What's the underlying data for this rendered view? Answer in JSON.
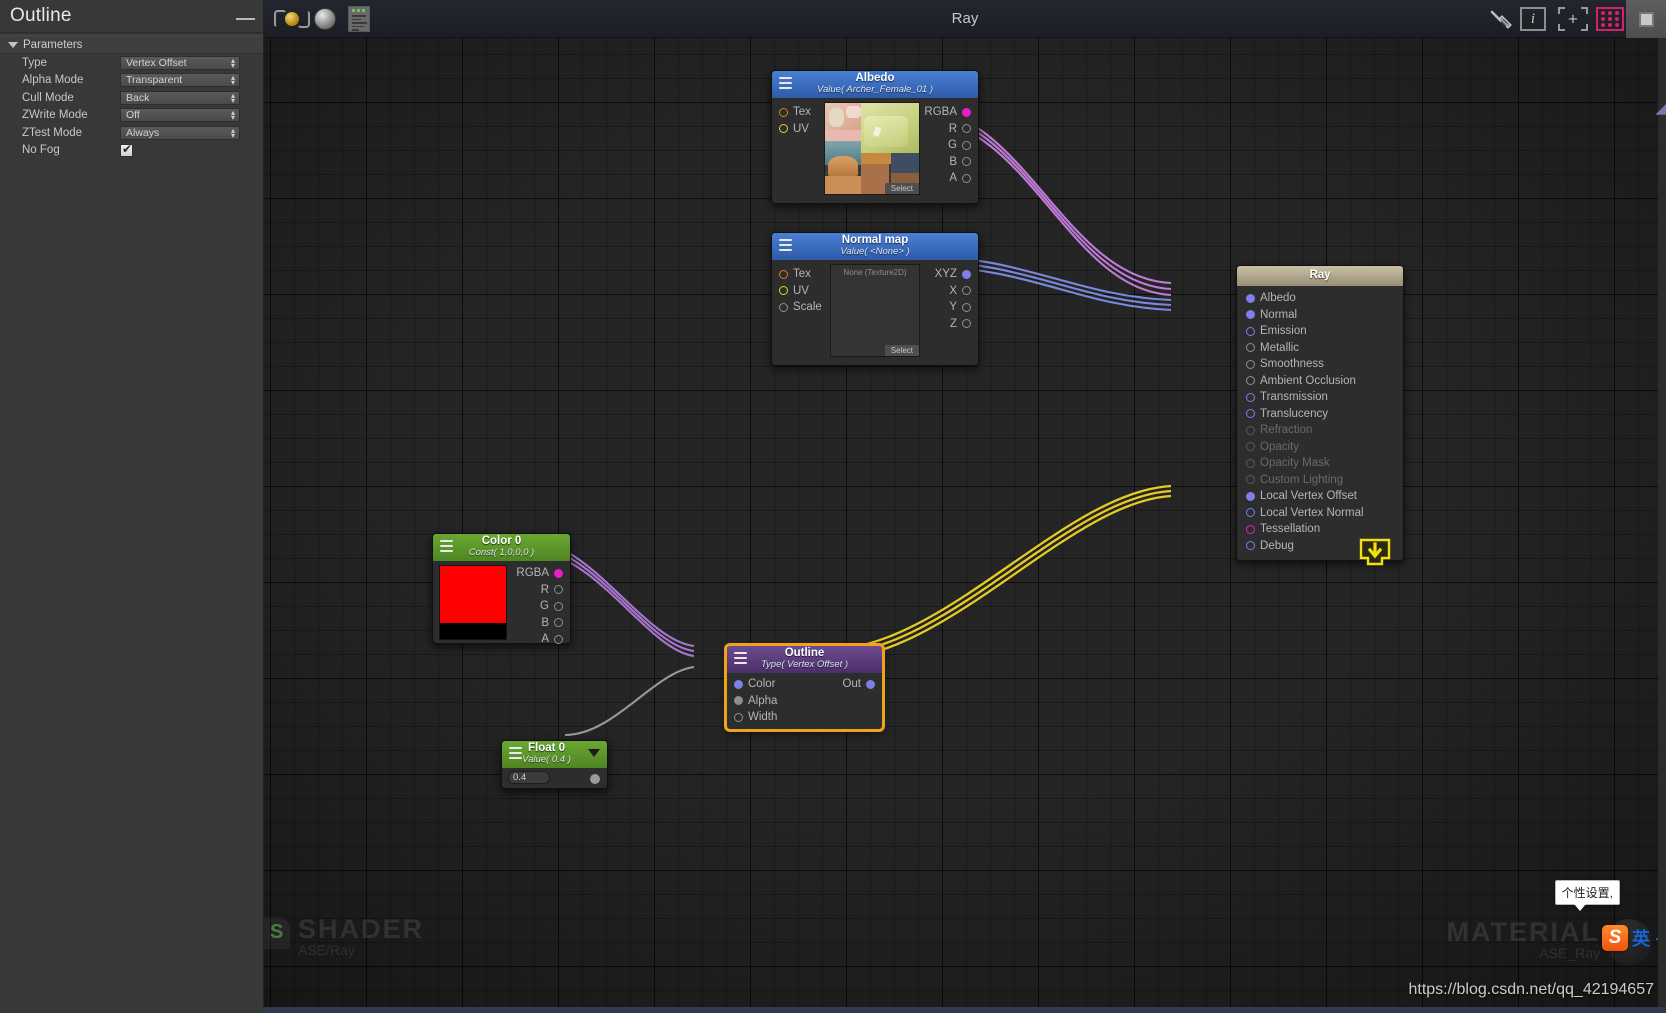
{
  "panel": {
    "title": "Outline",
    "section_label": "Parameters",
    "minimize_icon": "minimize-icon",
    "properties": [
      {
        "label": "Type",
        "value": "Vertex Offset",
        "control": "dropdown"
      },
      {
        "label": "Alpha Mode",
        "value": "Transparent",
        "control": "dropdown"
      },
      {
        "label": "Cull Mode",
        "value": "Back",
        "control": "dropdown"
      },
      {
        "label": "ZWrite Mode",
        "value": "Off",
        "control": "dropdown"
      },
      {
        "label": "ZTest Mode",
        "value": "Always",
        "control": "dropdown"
      },
      {
        "label": "No Fog",
        "value": "checked",
        "control": "checkbox"
      }
    ]
  },
  "toolbar": {
    "title": "Ray",
    "left_icons": [
      {
        "name": "update-material-icon",
        "glyph": "refresh"
      },
      {
        "name": "preview-sphere-icon",
        "glyph": "sphere"
      },
      {
        "name": "open-shader-source-icon",
        "glyph": "document"
      }
    ],
    "right_icons": [
      {
        "name": "cleanup-broom-icon",
        "glyph": "broom"
      },
      {
        "name": "info-icon",
        "glyph": "i"
      },
      {
        "name": "focus-selection-icon",
        "glyph": "plus-frame"
      },
      {
        "name": "toggle-grid-icon",
        "glyph": "grid"
      },
      {
        "name": "maximize-icon",
        "glyph": "square"
      }
    ]
  },
  "nodes": {
    "albedo": {
      "title": "Albedo",
      "subtitle": "Value( Archer_Female_01 )",
      "header_color": "#3f6dc4",
      "inputs": [
        {
          "label": "Tex",
          "dot": "orange",
          "filled": false
        },
        {
          "label": "UV",
          "dot": "yellow",
          "filled": false
        }
      ],
      "outputs": [
        {
          "label": "RGBA",
          "dot": "magenta",
          "filled": true
        },
        {
          "label": "R",
          "dot": "gray",
          "filled": false
        },
        {
          "label": "G",
          "dot": "gray",
          "filled": false
        },
        {
          "label": "B",
          "dot": "gray",
          "filled": false
        },
        {
          "label": "A",
          "dot": "gray",
          "filled": false
        }
      ],
      "select_button": "Select"
    },
    "normal_map": {
      "title": "Normal map",
      "subtitle": "Value( <None> )",
      "header_color": "#3f6dc4",
      "inputs": [
        {
          "label": "Tex",
          "dot": "orange",
          "filled": false
        },
        {
          "label": "UV",
          "dot": "yellow",
          "filled": false
        },
        {
          "label": "Scale",
          "dot": "gray",
          "filled": false
        }
      ],
      "outputs": [
        {
          "label": "XYZ",
          "dot": "blue",
          "filled": true
        },
        {
          "label": "X",
          "dot": "gray",
          "filled": false
        },
        {
          "label": "Y",
          "dot": "gray",
          "filled": false
        },
        {
          "label": "Z",
          "dot": "gray",
          "filled": false
        }
      ],
      "preview_placeholder": "None (Texture2D)",
      "select_button": "Select"
    },
    "color0": {
      "title": "Color 0",
      "subtitle": "Const( 1,0,0,0 )",
      "header_color": "#5e9a2d",
      "swatch_rgb": "#ff0000",
      "swatch_alpha": "#000000",
      "outputs": [
        {
          "label": "RGBA",
          "dot": "magenta",
          "filled": true
        },
        {
          "label": "R",
          "dot": "gray",
          "filled": false
        },
        {
          "label": "G",
          "dot": "gray",
          "filled": false
        },
        {
          "label": "B",
          "dot": "gray",
          "filled": false
        },
        {
          "label": "A",
          "dot": "gray",
          "filled": false
        }
      ]
    },
    "float0": {
      "title": "Float 0",
      "subtitle": "Value( 0.4 )",
      "header_color": "#5e9a2d",
      "field_value": "0.4",
      "dropdown_icon": "chevron-down-icon",
      "output_dot": "gray"
    },
    "outline": {
      "title": "Outline",
      "subtitle": "Type( Vertex Offset )",
      "header_color": "#5d3f82",
      "selected": true,
      "inputs": [
        {
          "label": "Color",
          "dot": "blue",
          "filled": true
        },
        {
          "label": "Alpha",
          "dot": "gray",
          "filled": true
        },
        {
          "label": "Width",
          "dot": "gray",
          "filled": false
        }
      ],
      "outputs": [
        {
          "label": "Out",
          "dot": "blue",
          "filled": true
        }
      ]
    },
    "ray_master": {
      "title": "Ray",
      "header_color": "#b4a78e",
      "ports": [
        {
          "label": "Albedo",
          "dot": "blue",
          "filled": true,
          "disabled": false
        },
        {
          "label": "Normal",
          "dot": "blue",
          "filled": true,
          "disabled": false
        },
        {
          "label": "Emission",
          "dot": "blue",
          "filled": false,
          "disabled": false
        },
        {
          "label": "Metallic",
          "dot": "gray",
          "filled": false,
          "disabled": false
        },
        {
          "label": "Smoothness",
          "dot": "gray",
          "filled": false,
          "disabled": false
        },
        {
          "label": "Ambient Occlusion",
          "dot": "gray",
          "filled": false,
          "disabled": false
        },
        {
          "label": "Transmission",
          "dot": "blue",
          "filled": false,
          "disabled": false
        },
        {
          "label": "Translucency",
          "dot": "blue",
          "filled": false,
          "disabled": false
        },
        {
          "label": "Refraction",
          "dot": "gray",
          "filled": false,
          "disabled": true
        },
        {
          "label": "Opacity",
          "dot": "gray",
          "filled": false,
          "disabled": true
        },
        {
          "label": "Opacity Mask",
          "dot": "gray",
          "filled": false,
          "disabled": true
        },
        {
          "label": "Custom Lighting",
          "dot": "gray",
          "filled": false,
          "disabled": true
        },
        {
          "label": "Local Vertex Offset",
          "dot": "blue",
          "filled": true,
          "disabled": false
        },
        {
          "label": "Local Vertex Normal",
          "dot": "blue",
          "filled": false,
          "disabled": false
        },
        {
          "label": "Tessellation",
          "dot": "magenta",
          "filled": false,
          "disabled": false
        },
        {
          "label": "Debug",
          "dot": "blue",
          "filled": false,
          "disabled": false
        }
      ],
      "badge_icon": "download-icon"
    }
  },
  "watermarks": {
    "shader_title": "SHADER",
    "shader_sub": "ASE/Ray",
    "shader_icon_letter": "S",
    "material_title": "MATERIAL",
    "material_sub": "ASE_Ray",
    "url": "https://blog.csdn.net/qq_42194657"
  },
  "ime": {
    "tooltip": "个性设置,",
    "logo_letter": "S",
    "mode": "英",
    "dot": "·"
  },
  "colors": {
    "accent_selected": "#f0a21a",
    "wire_albedo": "#c77fe0",
    "wire_normal": "#7f7fe8",
    "wire_outline": "#e8d024",
    "grid_magenta": "#d4216b"
  }
}
